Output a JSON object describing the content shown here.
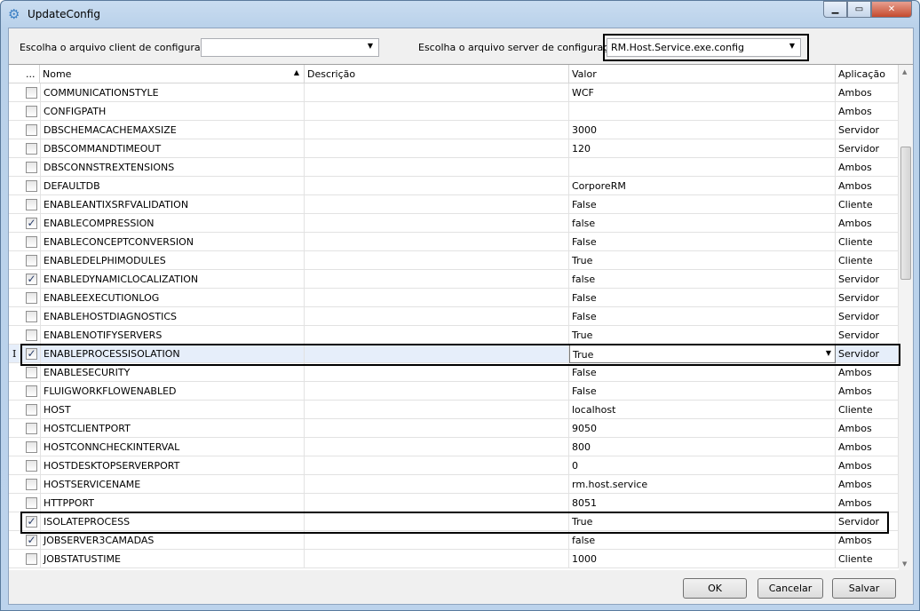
{
  "window": {
    "title": "UpdateConfig"
  },
  "client_label": "Escolha o arquivo client de configuração:",
  "client_value": "",
  "server_label": "Escolha o arquivo server de configuração:",
  "server_value": "RM.Host.Service.exe.config",
  "columns": {
    "indicator": "...",
    "nome": "Nome",
    "descricao": "Descrição",
    "valor": "Valor",
    "aplicacao": "Aplicação"
  },
  "rows": [
    {
      "nome": "COMMUNICATIONSTYLE",
      "valor": "WCF",
      "aplicacao": "Ambos",
      "checked": false
    },
    {
      "nome": "CONFIGPATH",
      "valor": "",
      "aplicacao": "Ambos",
      "checked": false
    },
    {
      "nome": "DBSCHEMACACHEMAXSIZE",
      "valor": "3000",
      "aplicacao": "Servidor",
      "checked": false
    },
    {
      "nome": "DBSCOMMANDTIMEOUT",
      "valor": "120",
      "aplicacao": "Servidor",
      "checked": false
    },
    {
      "nome": "DBSCONNSTREXTENSIONS",
      "valor": "",
      "aplicacao": "Ambos",
      "checked": false
    },
    {
      "nome": "DEFAULTDB",
      "valor": "CorporeRM",
      "aplicacao": "Ambos",
      "checked": false
    },
    {
      "nome": "ENABLEANTIXSRFVALIDATION",
      "valor": "False",
      "aplicacao": "Cliente",
      "checked": false
    },
    {
      "nome": "ENABLECOMPRESSION",
      "valor": "false",
      "aplicacao": "Ambos",
      "checked": true
    },
    {
      "nome": "ENABLECONCEPTCONVERSION",
      "valor": "False",
      "aplicacao": "Cliente",
      "checked": false
    },
    {
      "nome": "ENABLEDELPHIMODULES",
      "valor": "True",
      "aplicacao": "Cliente",
      "checked": false
    },
    {
      "nome": "ENABLEDYNAMICLOCALIZATION",
      "valor": "false",
      "aplicacao": "Servidor",
      "checked": true
    },
    {
      "nome": "ENABLEEXECUTIONLOG",
      "valor": "False",
      "aplicacao": "Servidor",
      "checked": false
    },
    {
      "nome": "ENABLEHOSTDIAGNOSTICS",
      "valor": "False",
      "aplicacao": "Servidor",
      "checked": false
    },
    {
      "nome": "ENABLENOTIFYSERVERS",
      "valor": "True",
      "aplicacao": "Servidor",
      "checked": false
    },
    {
      "nome": "ENABLEPROCESSISOLATION",
      "valor": "True",
      "aplicacao": "Servidor",
      "checked": true
    },
    {
      "nome": "ENABLESECURITY",
      "valor": "False",
      "aplicacao": "Ambos",
      "checked": false
    },
    {
      "nome": "FLUIGWORKFLOWENABLED",
      "valor": "False",
      "aplicacao": "Ambos",
      "checked": false
    },
    {
      "nome": "HOST",
      "valor": "localhost",
      "aplicacao": "Cliente",
      "checked": false
    },
    {
      "nome": "HOSTCLIENTPORT",
      "valor": "9050",
      "aplicacao": "Ambos",
      "checked": false
    },
    {
      "nome": "HOSTCONNCHECKINTERVAL",
      "valor": "800",
      "aplicacao": "Ambos",
      "checked": false
    },
    {
      "nome": "HOSTDESKTOPSERVERPORT",
      "valor": "0",
      "aplicacao": "Ambos",
      "checked": false
    },
    {
      "nome": "HOSTSERVICENAME",
      "valor": "rm.host.service",
      "aplicacao": "Ambos",
      "checked": false
    },
    {
      "nome": "HTTPPORT",
      "valor": "8051",
      "aplicacao": "Ambos",
      "checked": false
    },
    {
      "nome": "ISOLATEPROCESS",
      "valor": "True",
      "aplicacao": "Servidor",
      "checked": true
    },
    {
      "nome": "JOBSERVER3CAMADAS",
      "valor": "false",
      "aplicacao": "Ambos",
      "checked": true
    },
    {
      "nome": "JOBSTATUSTIME",
      "valor": "1000",
      "aplicacao": "Cliente",
      "checked": false
    }
  ],
  "editing_row_cursor": "I",
  "buttons": {
    "ok": "OK",
    "cancel": "Cancelar",
    "save": "Salvar"
  }
}
